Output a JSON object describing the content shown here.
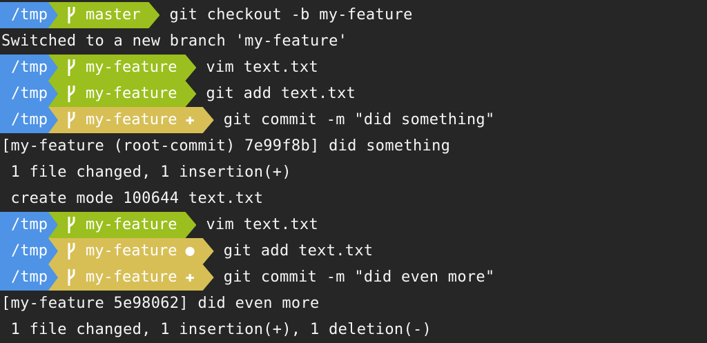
{
  "lines": [
    {
      "type": "prompt",
      "dir": "/tmp",
      "branch": "master",
      "state": "clean",
      "state_icon": "",
      "command": "git checkout -b my-feature"
    },
    {
      "type": "output",
      "text": "Switched to a new branch 'my-feature'"
    },
    {
      "type": "prompt",
      "dir": "/tmp",
      "branch": "my-feature",
      "state": "clean",
      "state_icon": "",
      "command": "vim text.txt"
    },
    {
      "type": "prompt",
      "dir": "/tmp",
      "branch": "my-feature",
      "state": "clean",
      "state_icon": "",
      "command": "git add text.txt"
    },
    {
      "type": "prompt",
      "dir": "/tmp",
      "branch": "my-feature",
      "state": "dirty",
      "state_icon": "✚",
      "command": "git commit -m \"did something\""
    },
    {
      "type": "output",
      "text": "[my-feature (root-commit) 7e99f8b] did something"
    },
    {
      "type": "output",
      "text": " 1 file changed, 1 insertion(+)"
    },
    {
      "type": "output",
      "text": " create mode 100644 text.txt"
    },
    {
      "type": "prompt",
      "dir": "/tmp",
      "branch": "my-feature",
      "state": "clean",
      "state_icon": "",
      "command": "vim text.txt"
    },
    {
      "type": "prompt",
      "dir": "/tmp",
      "branch": "my-feature",
      "state": "dirty",
      "state_icon": "●",
      "command": "git add text.txt"
    },
    {
      "type": "prompt",
      "dir": "/tmp",
      "branch": "my-feature",
      "state": "dirty",
      "state_icon": "✚",
      "command": "git commit -m \"did even more\""
    },
    {
      "type": "output",
      "text": "[my-feature 5e98062] did even more"
    },
    {
      "type": "output",
      "text": " 1 file changed, 1 insertion(+), 1 deletion(-)"
    }
  ],
  "colors": {
    "background": "#262626",
    "dir_segment": "#4e93e6",
    "branch_clean": "#9bbf1e",
    "branch_dirty": "#d7bf56",
    "text": "#f5f5f5"
  },
  "icons": {
    "branch": "git-branch-icon",
    "staged_changes": "plus-icon",
    "unstaged_changes": "dot-icon"
  }
}
